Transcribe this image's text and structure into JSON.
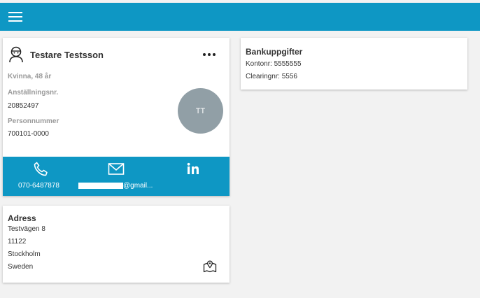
{
  "person": {
    "name": "Testare Testsson",
    "gender_age": "Kvinna, 48 år",
    "employee_no_label": "Anställningsnr.",
    "employee_no": "20852497",
    "personal_no_label": "Personnummer",
    "personal_no": "700101-0000",
    "initials": "TT"
  },
  "contact": {
    "phone": "070-6487878",
    "email": "@gmail..."
  },
  "bank": {
    "title": "Bankuppgifter",
    "account": "Kontonr: 5555555",
    "clearing": "Clearingnr: 5556"
  },
  "address": {
    "title": "Adress",
    "street": "Testvägen 8",
    "postal_code": "11122",
    "city": "Stockholm",
    "country": "Sweden"
  },
  "colors": {
    "accent": "#0e97c4",
    "avatar_bg": "#919fa6",
    "background": "#f2f2f2"
  },
  "icons": [
    "menu-icon",
    "person-icon",
    "more-icon",
    "phone-icon",
    "mail-icon",
    "linkedin-icon",
    "map-icon"
  ]
}
